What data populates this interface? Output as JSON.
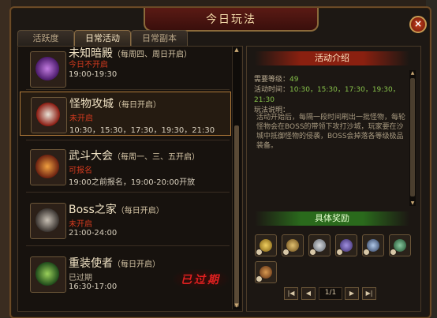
{
  "window": {
    "title": "今日玩法",
    "close_label": "×"
  },
  "tabs": [
    {
      "label": "活跃度"
    },
    {
      "label": "日常活动"
    },
    {
      "label": "日常副本"
    }
  ],
  "events": [
    {
      "name": "未知暗殿",
      "schedule": "（每周四、周日开启）",
      "status": "今日不开启",
      "time": "19:00-19:30",
      "status_color": "#d23a1e"
    },
    {
      "name": "怪物攻城",
      "schedule": "（每日开启）",
      "status": "未开启",
      "time": "10:30，15:30，17:30，19:30，21:30",
      "status_color": "#d23a1e"
    },
    {
      "name": "武斗大会",
      "schedule": "（每周一、三、五开启）",
      "status": "可报名",
      "time": "19:00之前报名，19:00-20:00开放",
      "status_color": "#d23a1e"
    },
    {
      "name": "Boss之家",
      "schedule": "（每日开启）",
      "status": "未开启",
      "time": "21:00-24:00",
      "status_color": "#d23a1e"
    },
    {
      "name": "重装使者",
      "schedule": "（每日开启）",
      "status": "已过期",
      "time": "16:30-17:00",
      "status_color": "#bfb39c"
    }
  ],
  "expired_stamp": "已过期",
  "info": {
    "header": "活动介绍",
    "level_label": "需要等级：",
    "level_value": "49",
    "time_label": "活动时间：",
    "time_value": "10:30，15:30，17:30，19:30，21:30",
    "desc_label": "玩法说明：",
    "description": "活动开始后，每隔一段时间刷出一批怪物，每轮怪物会在BOSS的带领下攻打沙城，玩家要在沙城中抵御怪物的侵袭，BOSS会掉落各等级极品装备。",
    "rewards_header": "具体奖励"
  },
  "pager": {
    "first": "|◀",
    "prev": "◀",
    "page": "1/1",
    "next": "▶",
    "last": "▶|"
  }
}
